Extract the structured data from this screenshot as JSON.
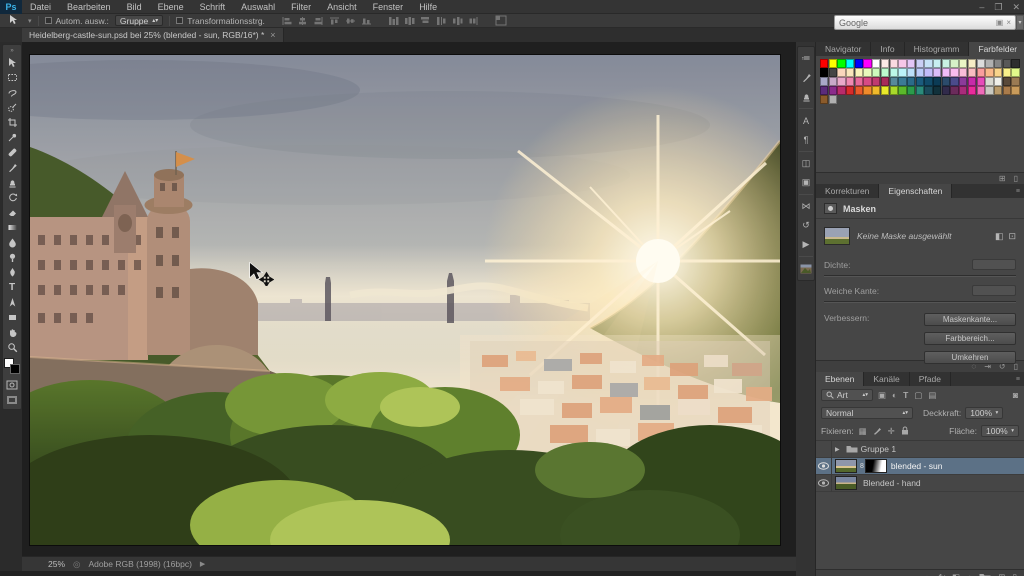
{
  "colors": {
    "chrome": "#343434",
    "panel": "#464646",
    "selection_blue": "#5c7186",
    "ps_logo_blue": "#3bb3e8",
    "pasteboard": "#1f1f1f"
  },
  "window": {
    "minimize": "–",
    "restore": "❐",
    "close": "✕"
  },
  "menu_bar": {
    "logo": "Ps",
    "items": [
      "Datei",
      "Bearbeiten",
      "Bild",
      "Ebene",
      "Schrift",
      "Auswahl",
      "Filter",
      "Ansicht",
      "Fenster",
      "Hilfe"
    ]
  },
  "options_bar": {
    "auto_select_label": "Autom. ausw.:",
    "auto_select_value": "Gruppe",
    "transform_label": "Transformationsstrg."
  },
  "document_tab": {
    "title": "Heidelberg-castle-sun.psd bei 25% (blended - sun, RGB/16*) *",
    "close": "×"
  },
  "google_bar": {
    "placeholder": "Google"
  },
  "swatches_panel": {
    "tabs": [
      "Navigator",
      "Info",
      "Histogramm",
      "Farbfelder"
    ],
    "active_tab": "Farbfelder",
    "colors": [
      "#ff0000",
      "#ffff00",
      "#00ff00",
      "#00ffff",
      "#0000ff",
      "#ff00ff",
      "#ffffff",
      "#fce9e6",
      "#fbd9e0",
      "#f6c7e8",
      "#e3c6f6",
      "#c9cef4",
      "#c5e1f6",
      "#c7eff2",
      "#c9f2e3",
      "#d6f2c7",
      "#eaf6c5",
      "#f6ecc5",
      "#dcdcdc",
      "#b0b0b0",
      "#858585",
      "#585858",
      "#2e2e2e",
      "#000000",
      "#454545",
      "#f9d6bc",
      "#f9e6bc",
      "#f9f4bc",
      "#e8f9bc",
      "#ccf9bc",
      "#bcf9cc",
      "#bcf9e8",
      "#bcf4f9",
      "#bce0f9",
      "#bcccf9",
      "#c1bcf9",
      "#d9bcf9",
      "#f0bcf9",
      "#f9bcf0",
      "#f9bcd9",
      "#f9bcc1",
      "#f99d9d",
      "#f9b98a",
      "#f9d48a",
      "#f9f08a",
      "#e1f98a",
      "#a9a9c9",
      "#c9a9c9",
      "#e9a9c9",
      "#ef8ab1",
      "#e76a9b",
      "#d74a85",
      "#bf3a6f",
      "#a72a59",
      "#56899b",
      "#3b7b95",
      "#2b6b89",
      "#1b5b7d",
      "#114b69",
      "#0b3b55",
      "#2b4b6b",
      "#4b4b8b",
      "#8b3b9b",
      "#c72ba9",
      "#e74bb9",
      "#d9d9d1",
      "#efefe9",
      "#594939",
      "#9b7b53",
      "#5b2b7b",
      "#8b2b8b",
      "#b92b6b",
      "#d92b2b",
      "#e95b2b",
      "#ef8b2b",
      "#efb92b",
      "#e9e92b",
      "#a9d92b",
      "#5bb92b",
      "#2b9b4b",
      "#2b8b7b",
      "#1b4b5b",
      "#11313b",
      "#312b4b",
      "#6b2b5b",
      "#a92b7b",
      "#e92b9b",
      "#ef6bb9",
      "#c9c9c1",
      "#b99b6b",
      "#a97b4b",
      "#c99b5b",
      "#8b5b2b",
      "#b0b0b0"
    ]
  },
  "properties_panel": {
    "tabs": [
      "Korrekturen",
      "Eigenschaften"
    ],
    "active_tab": "Eigenschaften",
    "header": "Masken",
    "mask_status": "Keine Maske ausgewählt",
    "density_label": "Dichte:",
    "feather_label": "Weiche Kante:",
    "refine_label": "Verbessern:",
    "btn_mask_edge": "Maskenkante...",
    "btn_color_range": "Farbbereich...",
    "btn_invert": "Umkehren"
  },
  "layers_panel": {
    "tabs": [
      "Ebenen",
      "Kanäle",
      "Pfade"
    ],
    "active_tab": "Ebenen",
    "filter_value": "Art",
    "blend_mode": "Normal",
    "opacity_label": "Deckkraft:",
    "opacity_value": "100%",
    "lock_label": "Fixieren:",
    "fill_label": "Fläche:",
    "fill_value": "100%",
    "layers": [
      {
        "name": "Gruppe 1",
        "type": "group"
      },
      {
        "name": "blended - sun",
        "type": "layer",
        "selected": true,
        "has_mask": true
      },
      {
        "name": "Blended - hand",
        "type": "layer"
      }
    ]
  },
  "status_bar": {
    "zoom": "25%",
    "doc_info": "Adobe RGB (1998) (16bpc)"
  }
}
